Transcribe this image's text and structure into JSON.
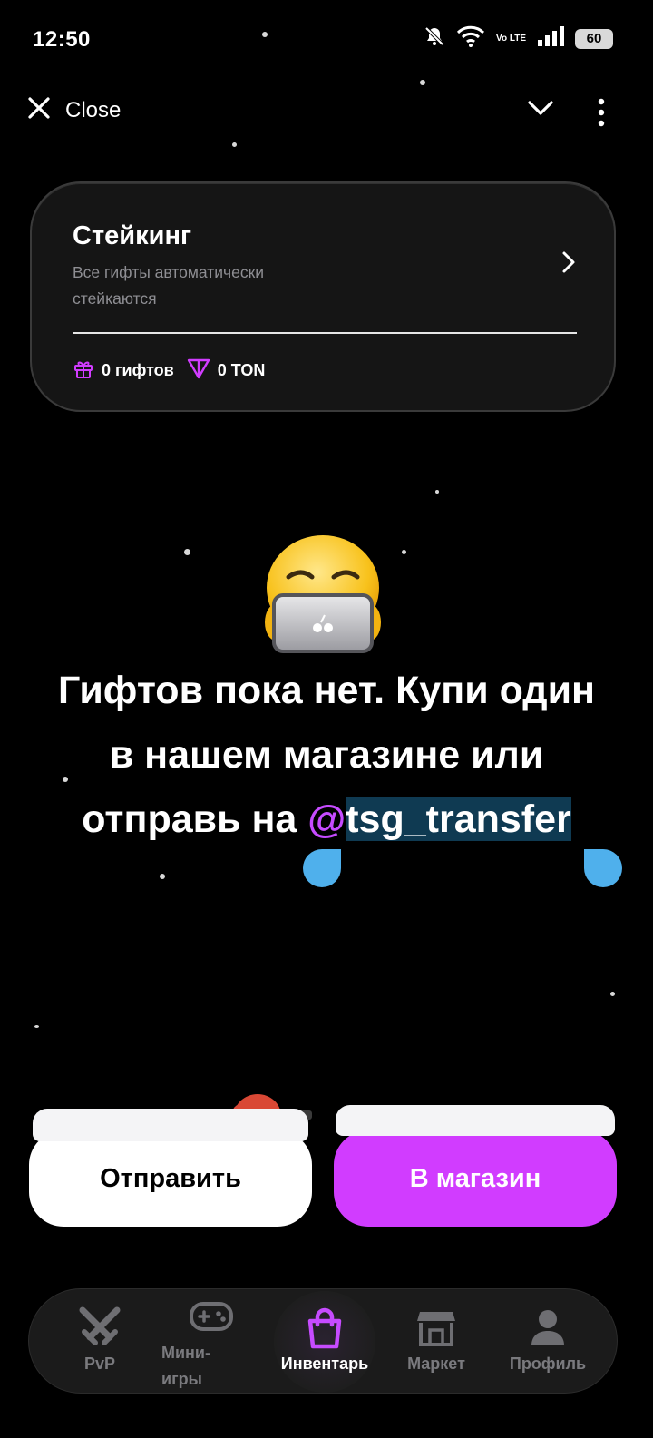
{
  "status_bar": {
    "time": "12:50",
    "battery": "60",
    "network": "Vo LTE"
  },
  "top_bar": {
    "close_label": "Close"
  },
  "staking_card": {
    "title": "Стейкинг",
    "subtitle": "Все гифты автоматически стейкаются",
    "gifts_count": "0 гифтов",
    "ton_amount": "0 TON"
  },
  "empty_state": {
    "line1": "Гифтов пока нет. Купи один",
    "line2": "в нашем магазине или",
    "line3_prefix": "отправь на ",
    "mention_at": "@",
    "mention_handle": "tsg_transfer"
  },
  "actions": {
    "send_label": "Отправить",
    "shop_label": "В магазин"
  },
  "nav": {
    "items": [
      {
        "label": "PvP",
        "icon": "crossed-swords-icon"
      },
      {
        "label": "Мини-игры",
        "icon": "gamepad-icon"
      },
      {
        "label": "Инвентарь",
        "icon": "shopping-bag-icon",
        "active": true
      },
      {
        "label": "Маркет",
        "icon": "storefront-icon"
      },
      {
        "label": "Профиль",
        "icon": "user-icon"
      }
    ]
  },
  "colors": {
    "accent": "#d13cff",
    "selection": "#0f3a52",
    "handle": "#4fb0ec"
  }
}
